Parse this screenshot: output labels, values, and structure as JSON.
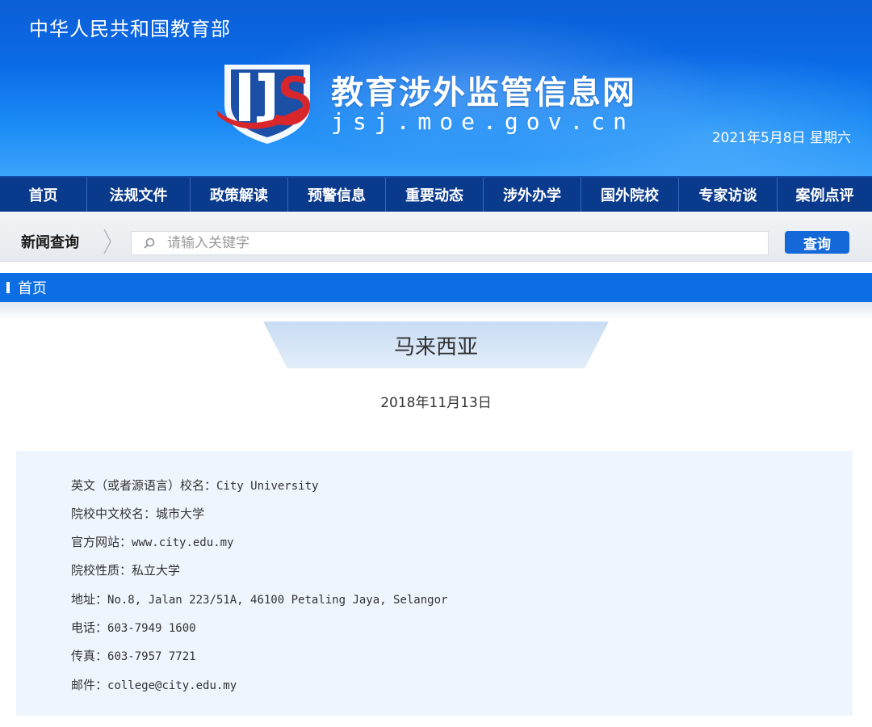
{
  "header": {
    "ministry": "中华人民共和国教育部",
    "site_title": "教育涉外监管信息网",
    "site_domain": "jsj.moe.gov.cn",
    "date": "2021年5月8日 星期六",
    "logo_icon": "jsj-shield-logo-icon"
  },
  "nav": {
    "items": [
      {
        "label": "首页"
      },
      {
        "label": "法规文件"
      },
      {
        "label": "政策解读"
      },
      {
        "label": "预警信息"
      },
      {
        "label": "重要动态"
      },
      {
        "label": "涉外办学"
      },
      {
        "label": "国外院校"
      },
      {
        "label": "专家访谈"
      },
      {
        "label": "案例点评"
      }
    ]
  },
  "search": {
    "label": "新闻查询",
    "placeholder": "请输入关键字",
    "value": "",
    "button_label": "查询"
  },
  "breadcrumb": {
    "home_label": "首页"
  },
  "article": {
    "country": "马来西亚",
    "date": "2018年11月13日",
    "fields": [
      {
        "label": "英文（或者源语言）校名：",
        "value": "City University"
      },
      {
        "label": "院校中文校名：",
        "value": "城市大学"
      },
      {
        "label": "官方网站：",
        "value": "www.city.edu.my"
      },
      {
        "label": "院校性质：",
        "value": "私立大学"
      },
      {
        "label": "地址：",
        "value": "No.8, Jalan 223/51A, 46100 Petaling Jaya, Selangor"
      },
      {
        "label": "电话：",
        "value": "603-7949 1600"
      },
      {
        "label": "传真：",
        "value": "603-7957 7721"
      },
      {
        "label": "邮件：",
        "value": "college@city.edu.my"
      }
    ]
  },
  "colors": {
    "banner_blue": "#0a6ae6",
    "nav_navy": "#0a3a8c",
    "accent_blue": "#0d6ee4",
    "button_blue": "#1468d8",
    "panel_bg": "#eef5fd"
  }
}
